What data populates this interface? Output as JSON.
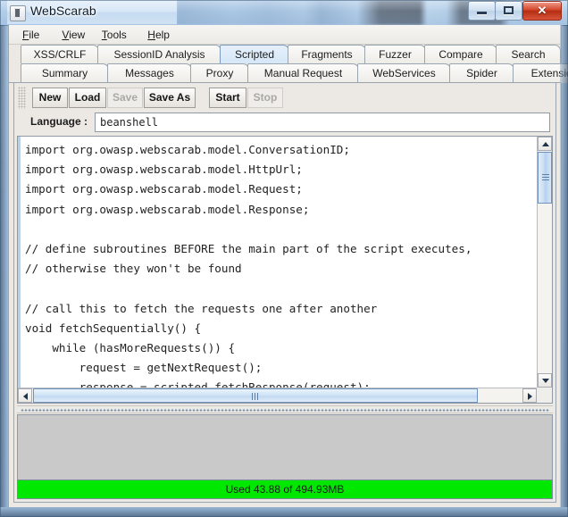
{
  "window": {
    "title": "WebScarab",
    "controls": {
      "minimize": "minimize-button",
      "maximize": "maximize-button",
      "close_glyph": "✕"
    }
  },
  "menubar": {
    "items": [
      {
        "label": "File",
        "mnemonic": "F",
        "rest": "ile"
      },
      {
        "label": "View",
        "mnemonic": "V",
        "rest": "iew"
      },
      {
        "label": "Tools",
        "mnemonic": "T",
        "rest": "ools"
      },
      {
        "label": "Help",
        "mnemonic": "H",
        "rest": "elp"
      }
    ]
  },
  "tabs": {
    "row1": [
      {
        "label": "XSS/CRLF",
        "selected": false
      },
      {
        "label": "SessionID Analysis",
        "selected": false
      },
      {
        "label": "Scripted",
        "selected": true
      },
      {
        "label": "Fragments",
        "selected": false
      },
      {
        "label": "Fuzzer",
        "selected": false
      },
      {
        "label": "Compare",
        "selected": false
      },
      {
        "label": "Search",
        "selected": false
      }
    ],
    "row2": [
      {
        "label": "Summary",
        "selected": false
      },
      {
        "label": "Messages",
        "selected": false
      },
      {
        "label": "Proxy",
        "selected": false
      },
      {
        "label": "Manual Request",
        "selected": false
      },
      {
        "label": "WebServices",
        "selected": false
      },
      {
        "label": "Spider",
        "selected": false
      },
      {
        "label": "Extensions",
        "selected": false
      }
    ]
  },
  "toolbar": {
    "buttons": [
      {
        "label": "New",
        "enabled": true
      },
      {
        "label": "Load",
        "enabled": true
      },
      {
        "label": "Save",
        "enabled": false
      },
      {
        "label": "Save As",
        "enabled": true
      },
      {
        "label": "Start",
        "enabled": true
      },
      {
        "label": "Stop",
        "enabled": false
      }
    ]
  },
  "language": {
    "label": "Language :",
    "value": "beanshell",
    "placeholder": ""
  },
  "editor": {
    "code": "import org.owasp.webscarab.model.ConversationID;\nimport org.owasp.webscarab.model.HttpUrl;\nimport org.owasp.webscarab.model.Request;\nimport org.owasp.webscarab.model.Response;\n\n// define subroutines BEFORE the main part of the script executes,\n// otherwise they won't be found\n\n// call this to fetch the requests one after another\nvoid fetchSequentially() {\n    while (hasMoreRequests()) {\n        request = getNextRequest();\n        response = scripted.fetchResponse(request);\n        out.println(\"Conversation \" + scripted.addConversation(response))"
  },
  "output_panel": {
    "content": ""
  },
  "status": {
    "memory_text": "Used 43.88 of 494.93MB",
    "memory_color": "#00e800"
  },
  "colors": {
    "selected_tab": "#d6e7f8",
    "frame": "#9dbcdd",
    "panel_bg": "#ece9e4"
  }
}
